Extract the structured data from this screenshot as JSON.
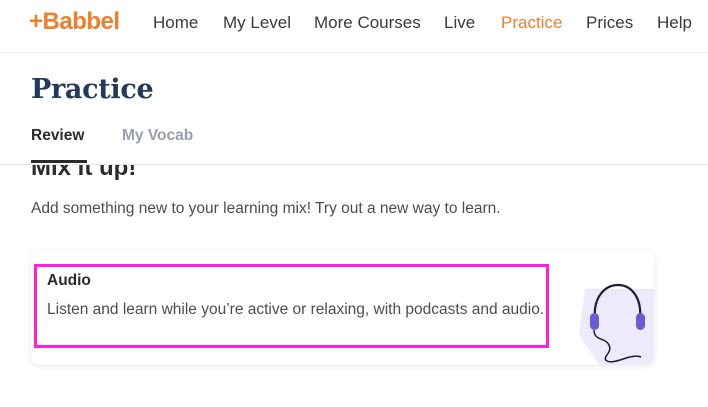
{
  "header": {
    "logo": "+Babbel",
    "nav": [
      {
        "label": "Home"
      },
      {
        "label": "My Level"
      },
      {
        "label": "More Courses"
      },
      {
        "label": "Live"
      },
      {
        "label": "Practice",
        "active": true
      },
      {
        "label": "Prices"
      },
      {
        "label": "Help"
      }
    ]
  },
  "page": {
    "title": "Practice",
    "tabs": [
      {
        "label": "Review",
        "active": true
      },
      {
        "label": "My Vocab"
      }
    ]
  },
  "section": {
    "title": "Mix it up!",
    "subtitle": "Add something new to your learning mix! Try out a new way to learn."
  },
  "card": {
    "title": "Audio",
    "description": "Listen and learn while you’re active or relaxing, with podcasts and audio.",
    "illustration_icon": "headphones-icon"
  },
  "colors": {
    "brand": "#f07e2a",
    "title": "#23395d",
    "highlight": "#ff1ee4",
    "illustration_bg": "#efeafb",
    "illustration_accent": "#6a5bd6"
  }
}
